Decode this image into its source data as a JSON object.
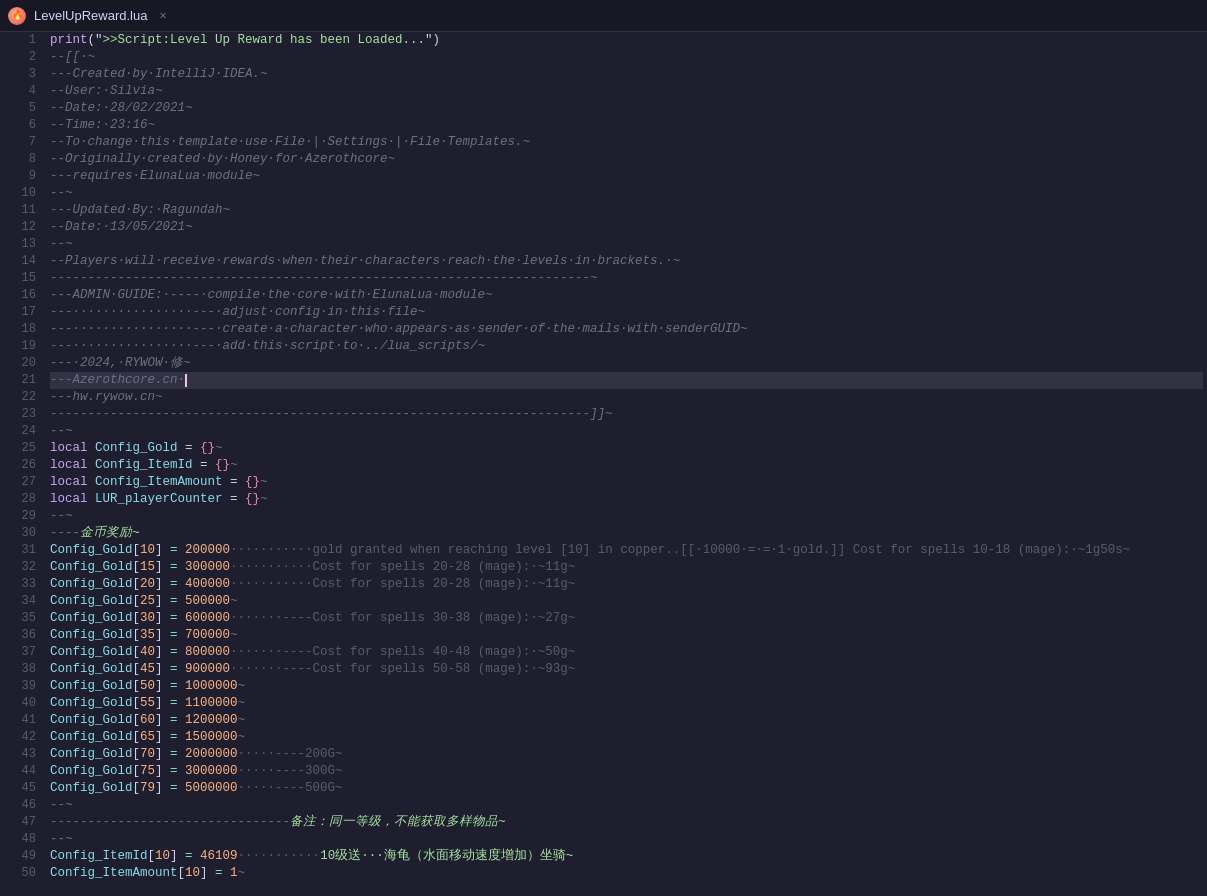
{
  "titlebar": {
    "title": "LevelUpReward.lua",
    "close_label": "✕"
  },
  "lines": [
    {
      "num": 1,
      "content": "print",
      "type": "code1"
    },
    {
      "num": 2,
      "content": "--[[·~",
      "type": "comment"
    },
    {
      "num": 3,
      "content": "---Created·by·IntelliJ·IDEA.~",
      "type": "comment"
    },
    {
      "num": 4,
      "content": "--User:·Silvia~",
      "type": "comment"
    },
    {
      "num": 5,
      "content": "--Date:·28/02/2021~",
      "type": "comment"
    },
    {
      "num": 6,
      "content": "--Time:·23:16~",
      "type": "comment"
    },
    {
      "num": 7,
      "content": "--To·change·this·template·use·File·|·Settings·|·File·Templates.~",
      "type": "comment"
    },
    {
      "num": 8,
      "content": "--Originally·created·by·Honey·for·Azerothcore~",
      "type": "comment"
    },
    {
      "num": 9,
      "content": "---requires·ElunaLua·module~",
      "type": "comment"
    },
    {
      "num": 10,
      "content": "--~",
      "type": "comment"
    },
    {
      "num": 11,
      "content": "---Updated·By:·Ragundah~",
      "type": "comment"
    },
    {
      "num": 12,
      "content": "--Date:·13/05/2021~",
      "type": "comment"
    },
    {
      "num": 13,
      "content": "--~",
      "type": "comment"
    },
    {
      "num": 14,
      "content": "--Players·will·receive·rewards·when·their·characters·reach·the·levels·in·brackets.·~",
      "type": "comment"
    },
    {
      "num": 15,
      "content": "------------------------------------------------------------------------~",
      "type": "comment"
    },
    {
      "num": 16,
      "content": "---ADMIN·GUIDE:·----·compile·the·core·with·ElunaLua·module~",
      "type": "comment"
    },
    {
      "num": 17,
      "content": "---················---·adjust·config·in·this·file~",
      "type": "comment"
    },
    {
      "num": 18,
      "content": "---················---·create·a·character·who·appears·as·sender·of·the·mails·with·senderGUID~",
      "type": "comment"
    },
    {
      "num": 19,
      "content": "---················---·add·this·script·to·../lua_scripts/~",
      "type": "comment"
    },
    {
      "num": 20,
      "content": "---·2024,·RYWOW·修~",
      "type": "comment"
    },
    {
      "num": 21,
      "content": "---Azerothcore.cn·|",
      "type": "comment_cursor"
    },
    {
      "num": 22,
      "content": "---hw.rywow.cn~",
      "type": "comment"
    },
    {
      "num": 23,
      "content": "------------------------------------------------------------------------]]~",
      "type": "comment"
    },
    {
      "num": 24,
      "content": "--~",
      "type": "comment"
    },
    {
      "num": 25,
      "content": "local Config_Gold = {}~",
      "type": "code_local"
    },
    {
      "num": 26,
      "content": "local Config_ItemId = {}~",
      "type": "code_local"
    },
    {
      "num": 27,
      "content": "local Config_ItemAmount = {}~",
      "type": "code_local"
    },
    {
      "num": 28,
      "content": "local LUR_playerCounter = {}~",
      "type": "code_local"
    },
    {
      "num": 29,
      "content": "--~",
      "type": "comment"
    },
    {
      "num": 30,
      "content": "----金币奖励~",
      "type": "comment_cn"
    },
    {
      "num": 31,
      "content": "Config_Gold[10]·=·200000···········gold·granted·when·reaching·level·[10]·in·copper..[[·10000·=·=·1·gold.]]·Cost·for·spells·10-18·(mage):·~1g50s~",
      "type": "code_gold"
    },
    {
      "num": 32,
      "content": "Config_Gold[15]·=·300000···········Cost·for·spells·20-28·(mage):·~11g~",
      "type": "code_gold"
    },
    {
      "num": 33,
      "content": "Config_Gold[20]·=·400000···········Cost·for·spells·20-28·(mage):·~11g~",
      "type": "code_gold2"
    },
    {
      "num": 34,
      "content": "Config_Gold[25]·=·500000~",
      "type": "code_gold3"
    },
    {
      "num": 35,
      "content": "Config_Gold[30]·=·600000·······----Cost·for·spells·30-38·(mage):·~27g~",
      "type": "code_gold"
    },
    {
      "num": 36,
      "content": "Config_Gold[35]·=·700000~",
      "type": "code_gold3"
    },
    {
      "num": 37,
      "content": "Config_Gold[40]·=·800000·······----Cost·for·spells·40-48·(mage):·~50g~",
      "type": "code_gold"
    },
    {
      "num": 38,
      "content": "Config_Gold[45]·=·900000·······----Cost·for·spells·50-58·(mage):·~93g~",
      "type": "code_gold"
    },
    {
      "num": 39,
      "content": "Config_Gold[50]·=·1000000~",
      "type": "code_gold3"
    },
    {
      "num": 40,
      "content": "Config_Gold[55]·=·1100000~",
      "type": "code_gold3"
    },
    {
      "num": 41,
      "content": "Config_Gold[60]·=·1200000~",
      "type": "code_gold3"
    },
    {
      "num": 42,
      "content": "Config_Gold[65]·=·1500000~",
      "type": "code_gold3"
    },
    {
      "num": 43,
      "content": "Config_Gold[70]·=·2000000·····----200G~",
      "type": "code_gold4"
    },
    {
      "num": 44,
      "content": "Config_Gold[75]·=·3000000·····----300G~",
      "type": "code_gold4"
    },
    {
      "num": 45,
      "content": "Config_Gold[79]·=·5000000·····----500G~",
      "type": "code_gold4"
    },
    {
      "num": 46,
      "content": "--~",
      "type": "comment"
    },
    {
      "num": 47,
      "content": "--------------------------------备注：同一等级，不能获取多样物品~",
      "type": "comment_cn2"
    },
    {
      "num": 48,
      "content": "--~",
      "type": "comment"
    },
    {
      "num": 49,
      "content": "Config_ItemId[10]·=·46109···········10级送···海龟（水面移动速度增加）坐骑~",
      "type": "code_item"
    },
    {
      "num": 50,
      "content": "Config_ItemAmount[10]·=·1~",
      "type": "code_item2"
    }
  ]
}
